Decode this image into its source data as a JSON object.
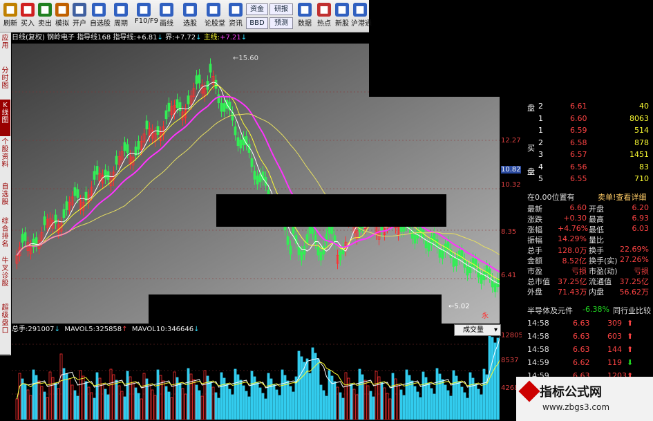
{
  "toolbar": {
    "buttons": [
      {
        "label": "刷新",
        "icon": "refresh-icon",
        "color": "#c08000"
      },
      {
        "label": "买入",
        "icon": "buy-icon",
        "color": "#d02020"
      },
      {
        "label": "卖出",
        "icon": "sell-icon",
        "color": "#208020"
      },
      {
        "label": "模拟",
        "icon": "hammer-icon",
        "color": "#c06000"
      },
      {
        "label": "开户",
        "icon": "lock-icon",
        "color": "#4060a0"
      },
      {
        "label": "自选股",
        "icon": "add-icon",
        "color": "#3060c0"
      },
      {
        "label": "周期",
        "icon": "clock-icon",
        "color": "#3060c0"
      },
      {
        "label": "F10/F9",
        "icon": "f10-icon",
        "color": "#3060c0"
      },
      {
        "label": "画线",
        "icon": "pencil-icon",
        "color": "#3060c0"
      },
      {
        "label": "选股",
        "icon": "filter-icon",
        "color": "#3060c0"
      },
      {
        "label": "论股堂",
        "icon": "chat-icon",
        "color": "#3060c0"
      },
      {
        "label": "资讯",
        "icon": "news-icon",
        "color": "#3060c0"
      },
      {
        "label": "数据",
        "icon": "pe-icon",
        "color": "#3060c0"
      },
      {
        "label": "热点",
        "icon": "fire-icon",
        "color": "#c03030"
      },
      {
        "label": "新股",
        "icon": "newstock-icon",
        "color": "#3060c0"
      },
      {
        "label": "沪港通",
        "icon": "hk-icon",
        "color": "#3060c0"
      }
    ],
    "small": {
      "fund": "资金",
      "bbd": "BBD",
      "research": "研报",
      "forecast": "预测"
    }
  },
  "header": {
    "period": "日线(复权)",
    "stock": "钢岭电子",
    "indicator": "指导线168",
    "ind_label": "指导线:",
    "ind_value": "+6.81",
    "jie_label": "界:",
    "jie_value": "+7.72",
    "main_label": "主线:",
    "main_value": "+7.21"
  },
  "side_tabs": [
    "应用",
    "分时图",
    "K线图",
    "个股资料",
    "自选股",
    "综合排名",
    "牛叉诊股",
    "超级盘口"
  ],
  "chart": {
    "price_axis": [
      "12.27",
      "10.82",
      "10.32",
      "8.35",
      "6.41"
    ],
    "high_marker": "15.60",
    "low_marker": "5.02",
    "badge": "永"
  },
  "volume": {
    "total_label": "总手:",
    "total_value": "291007",
    "ma5_label": "MAVOL5:",
    "ma5_value": "325858",
    "ma10_label": "MAVOL10:",
    "ma10_value": "346646",
    "dropdown": "成交量",
    "axis": [
      "12805",
      "8537",
      "4268"
    ]
  },
  "chart_data": {
    "type": "bar",
    "title": "",
    "price_ticks": [
      12.27,
      10.82,
      10.32,
      8.35,
      6.41
    ],
    "high": 15.6,
    "low": 5.02,
    "volume_ticks": [
      12805,
      8537,
      4268
    ]
  },
  "quote": {
    "sell_label": "盘",
    "buy_label": "买",
    "buy_label2": "盘",
    "order_book": [
      {
        "lvl": "2",
        "price": "6.61",
        "vol": "40"
      },
      {
        "lvl": "1",
        "price": "6.60",
        "vol": "8063"
      },
      {
        "lvl": "1",
        "price": "6.59",
        "vol": "514"
      },
      {
        "lvl": "2",
        "price": "6.58",
        "vol": "878"
      },
      {
        "lvl": "3",
        "price": "6.57",
        "vol": "1451"
      },
      {
        "lvl": "4",
        "price": "6.56",
        "vol": "83"
      },
      {
        "lvl": "5",
        "price": "6.55",
        "vol": "710"
      }
    ],
    "position": "在0.00位置有",
    "detail_link": "卖单!查看详细",
    "stats": [
      {
        "l1": "最新",
        "v1": "6.60",
        "l2": "开盘",
        "v2": "6.20"
      },
      {
        "l1": "涨跌",
        "v1": "+0.30",
        "l2": "最高",
        "v2": "6.93"
      },
      {
        "l1": "涨幅",
        "v1": "+4.76%",
        "l2": "最低",
        "v2": "6.03"
      },
      {
        "l1": "振幅",
        "v1": "14.29%",
        "l2": "量比",
        "v2": ""
      },
      {
        "l1": "总手",
        "v1": "128.0万",
        "l2": "换手",
        "v2": "22.69%"
      },
      {
        "l1": "金额",
        "v1": "8.52亿",
        "l2": "换手(实)",
        "v2": "27.26%"
      },
      {
        "l1": "市盈",
        "v1": "亏损",
        "l2": "市盈(动)",
        "v2": "亏损"
      },
      {
        "l1": "总市值",
        "v1": "37.25亿",
        "l2": "流通值",
        "v2": "37.25亿"
      },
      {
        "l1": "外盘",
        "v1": "71.43万",
        "l2": "内盘",
        "v2": "56.62万"
      }
    ],
    "sector": "半导体及元件",
    "sector_change": "-6.38%",
    "compare": "同行业比较",
    "ticks": [
      {
        "t": "14:58",
        "p": "6.63",
        "v": "309"
      },
      {
        "t": "14:58",
        "p": "6.63",
        "v": "603"
      },
      {
        "t": "14:58",
        "p": "6.63",
        "v": "144"
      },
      {
        "t": "14:59",
        "p": "6.62",
        "v": "119"
      },
      {
        "t": "14:59",
        "p": "6.63",
        "v": "1203"
      }
    ]
  },
  "watermark": {
    "title": "指标公式网",
    "url": "www.zbgs3.com"
  }
}
